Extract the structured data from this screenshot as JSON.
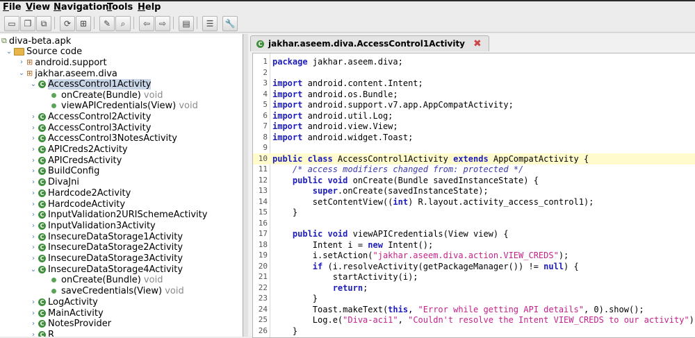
{
  "menu": [
    {
      "label": "File",
      "underline": "F",
      "rest": "ile"
    },
    {
      "label": "View",
      "underline": "V",
      "rest": "iew"
    },
    {
      "label": "Navigation",
      "underline": "N",
      "rest": "avigation"
    },
    {
      "label": "Tools",
      "underline": "T",
      "rest": "ools"
    },
    {
      "label": "Help",
      "underline": "H",
      "rest": "elp"
    }
  ],
  "toolbar": {
    "buttons": [
      "open-file-icon",
      "save-all-icon",
      "export-icon",
      "sync-icon",
      "grid-icon",
      "wand-icon",
      "search-icon",
      "back-icon",
      "forward-icon",
      "log-icon",
      "settings-list-icon",
      "preferences-icon"
    ]
  },
  "tree": {
    "root": "diva-beta.apk",
    "source_code": "Source code",
    "packages": [
      "android.support",
      "jakhar.aseem.diva"
    ],
    "selected_class": "AccessControl1Activity",
    "selected_methods": [
      {
        "name": "onCreate(Bundle)",
        "ret": "void"
      },
      {
        "name": "viewAPICredentials(View)",
        "ret": "void"
      }
    ],
    "classes_a": [
      "AccessControl2Activity",
      "AccessControl3Activity",
      "AccessControl3NotesActivity",
      "APICreds2Activity",
      "APICredsActivity",
      "BuildConfig",
      "DivaJni",
      "Hardcode2Activity",
      "HardcodeActivity",
      "InputValidation2URISchemeActivity",
      "InputValidation3Activity",
      "InsecureDataStorage1Activity",
      "InsecureDataStorage2Activity",
      "InsecureDataStorage3Activity"
    ],
    "expanded_class": "InsecureDataStorage4Activity",
    "expanded_methods": [
      {
        "name": "onCreate(Bundle)",
        "ret": "void"
      },
      {
        "name": "saveCredentials(View)",
        "ret": "void"
      }
    ],
    "classes_b": [
      "LogActivity",
      "MainActivity",
      "NotesProvider",
      "R"
    ]
  },
  "editor": {
    "tab_title": "jakhar.aseem.diva.AccessControl1Activity",
    "highlight_line": 10,
    "lines": [
      [
        {
          "t": "kw",
          "v": "package"
        },
        {
          "t": "pl",
          "v": " jakhar.aseem.diva;"
        }
      ],
      [],
      [
        {
          "t": "kw",
          "v": "import"
        },
        {
          "t": "pl",
          "v": " android.content.Intent;"
        }
      ],
      [
        {
          "t": "kw",
          "v": "import"
        },
        {
          "t": "pl",
          "v": " android.os.Bundle;"
        }
      ],
      [
        {
          "t": "kw",
          "v": "import"
        },
        {
          "t": "pl",
          "v": " android.support.v7.app.AppCompatActivity;"
        }
      ],
      [
        {
          "t": "kw",
          "v": "import"
        },
        {
          "t": "pl",
          "v": " android.util.Log;"
        }
      ],
      [
        {
          "t": "kw",
          "v": "import"
        },
        {
          "t": "pl",
          "v": " android.view.View;"
        }
      ],
      [
        {
          "t": "kw",
          "v": "import"
        },
        {
          "t": "pl",
          "v": " android.widget.Toast;"
        }
      ],
      [],
      [
        {
          "t": "kw",
          "v": "public class"
        },
        {
          "t": "pl",
          "v": " AccessControl1Activity "
        },
        {
          "t": "kw",
          "v": "extends"
        },
        {
          "t": "pl",
          "v": " AppCompatActivity {"
        }
      ],
      [
        {
          "t": "pl",
          "v": "    "
        },
        {
          "t": "cm",
          "v": "/* access modifiers changed from: protected */"
        }
      ],
      [
        {
          "t": "pl",
          "v": "    "
        },
        {
          "t": "kw",
          "v": "public void"
        },
        {
          "t": "pl",
          "v": " onCreate(Bundle savedInstanceState) {"
        }
      ],
      [
        {
          "t": "pl",
          "v": "        "
        },
        {
          "t": "kw",
          "v": "super"
        },
        {
          "t": "pl",
          "v": ".onCreate(savedInstanceState);"
        }
      ],
      [
        {
          "t": "pl",
          "v": "        setContentView(("
        },
        {
          "t": "kw",
          "v": "int"
        },
        {
          "t": "pl",
          "v": ") R.layout.activity_access_control1);"
        }
      ],
      [
        {
          "t": "pl",
          "v": "    }"
        }
      ],
      [],
      [
        {
          "t": "pl",
          "v": "    "
        },
        {
          "t": "kw",
          "v": "public void"
        },
        {
          "t": "pl",
          "v": " viewAPICredentials(View view) {"
        }
      ],
      [
        {
          "t": "pl",
          "v": "        Intent i = "
        },
        {
          "t": "kw",
          "v": "new"
        },
        {
          "t": "pl",
          "v": " Intent();"
        }
      ],
      [
        {
          "t": "pl",
          "v": "        i.setAction("
        },
        {
          "t": "str",
          "v": "\"jakhar.aseem.diva.action.VIEW_CREDS\""
        },
        {
          "t": "pl",
          "v": ");"
        }
      ],
      [
        {
          "t": "pl",
          "v": "        "
        },
        {
          "t": "kw",
          "v": "if"
        },
        {
          "t": "pl",
          "v": " (i.resolveActivity(getPackageManager()) != "
        },
        {
          "t": "kw",
          "v": "null"
        },
        {
          "t": "pl",
          "v": ") {"
        }
      ],
      [
        {
          "t": "pl",
          "v": "            startActivity(i);"
        }
      ],
      [
        {
          "t": "pl",
          "v": "            "
        },
        {
          "t": "kw",
          "v": "return"
        },
        {
          "t": "pl",
          "v": ";"
        }
      ],
      [
        {
          "t": "pl",
          "v": "        }"
        }
      ],
      [
        {
          "t": "pl",
          "v": "        Toast.makeText("
        },
        {
          "t": "kw",
          "v": "this"
        },
        {
          "t": "pl",
          "v": ", "
        },
        {
          "t": "str",
          "v": "\"Error while getting API details\""
        },
        {
          "t": "pl",
          "v": ", 0).show();"
        }
      ],
      [
        {
          "t": "pl",
          "v": "        Log.e("
        },
        {
          "t": "str",
          "v": "\"Diva-aci1\""
        },
        {
          "t": "pl",
          "v": ", "
        },
        {
          "t": "str",
          "v": "\"Couldn't resolve the Intent VIEW_CREDS to our activity\""
        },
        {
          "t": "pl",
          "v": ");"
        }
      ],
      [
        {
          "t": "pl",
          "v": "    }"
        }
      ],
      [
        {
          "t": "pl",
          "v": "}"
        }
      ]
    ]
  }
}
